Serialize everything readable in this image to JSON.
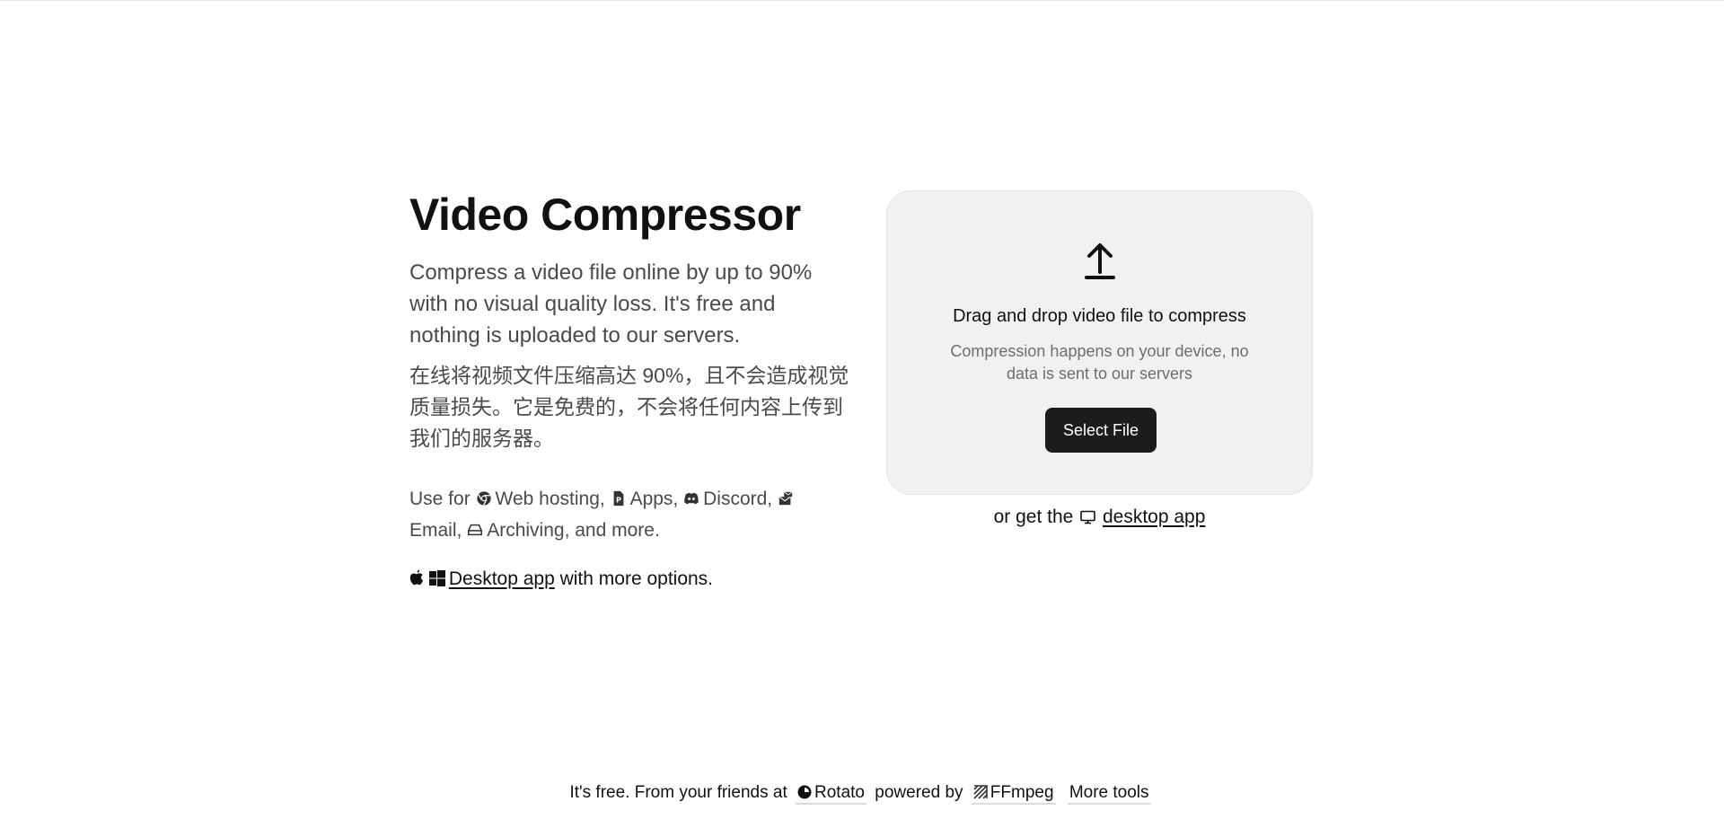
{
  "hero": {
    "title": "Video Compressor",
    "description": "Compress a video file online by up to 90% with no visual quality loss. It's free and nothing is uploaded to our servers.",
    "description_cn": "在线将视频文件压缩高达 90%，且不会造成视觉质量损失。它是免费的，不会将任何内容上传到我们的服务器。",
    "use_for": {
      "prefix": "Use for",
      "items": [
        {
          "icon": "chrome-icon",
          "label": "Web hosting,"
        },
        {
          "icon": "app-file-icon",
          "label": "Apps,"
        },
        {
          "icon": "discord-icon",
          "label": "Discord,"
        },
        {
          "icon": "mail-icon",
          "label": "Email,"
        },
        {
          "icon": "archive-drive-icon",
          "label": "Archiving, and more."
        }
      ]
    },
    "desktop_line": {
      "icons": [
        "apple-icon",
        "windows-icon"
      ],
      "link_label": "Desktop app",
      "suffix": " with more options."
    }
  },
  "dropzone": {
    "icon": "upload-arrow-icon",
    "title": "Drag and drop video file to compress",
    "subtitle": "Compression happens on your device, no data is sent to our servers",
    "button_label": "Select File"
  },
  "get_app": {
    "prefix": "or get the ",
    "icon": "monitor-icon",
    "link_label": "desktop app"
  },
  "footer": {
    "prefix": "It's free. From your friends at",
    "rotato_label": "Rotato",
    "powered_by": "powered by",
    "ffmpeg_label": "FFmpeg",
    "more_tools_label": "More tools"
  },
  "colors": {
    "button_bg": "#1c1c1c",
    "dropzone_bg": "#f1f1f1",
    "muted_text": "#4a4a4a"
  }
}
